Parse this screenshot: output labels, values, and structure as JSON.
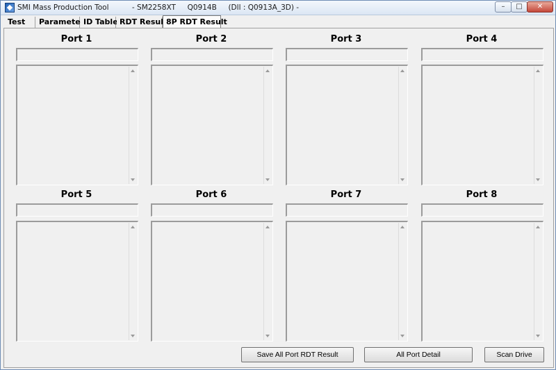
{
  "window": {
    "title": "SMI Mass Production Tool          - SM2258XT     Q0914B     (Dll : Q0913A_3D) -",
    "min_glyph": "–",
    "max_glyph": "□",
    "close_glyph": "✕"
  },
  "tabs": [
    {
      "label": "Test"
    },
    {
      "label": "Parameter"
    },
    {
      "label": "ID Table"
    },
    {
      "label": "RDT Result"
    },
    {
      "label": "8P RDT Result",
      "active": true
    }
  ],
  "ports": [
    {
      "title": "Port 1",
      "value": "",
      "log": ""
    },
    {
      "title": "Port 2",
      "value": "",
      "log": ""
    },
    {
      "title": "Port 3",
      "value": "",
      "log": ""
    },
    {
      "title": "Port 4",
      "value": "",
      "log": ""
    },
    {
      "title": "Port 5",
      "value": "",
      "log": ""
    },
    {
      "title": "Port 6",
      "value": "",
      "log": ""
    },
    {
      "title": "Port 7",
      "value": "",
      "log": ""
    },
    {
      "title": "Port 8",
      "value": "",
      "log": ""
    }
  ],
  "buttons": {
    "save_all": "Save All Port RDT Result",
    "all_detail": "All Port Detail",
    "scan_drive": "Scan Drive"
  }
}
